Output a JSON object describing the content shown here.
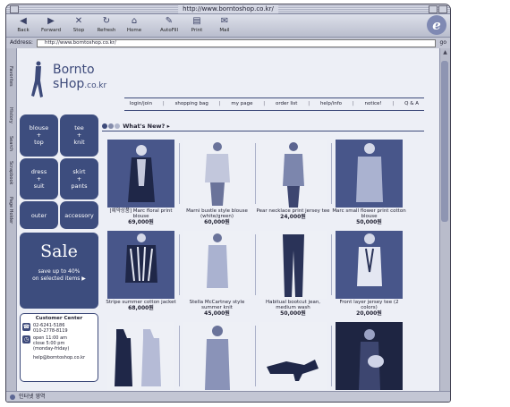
{
  "window": {
    "title": "http://www.borntoshop.co.kr/"
  },
  "toolbar": {
    "buttons": [
      {
        "label": "Back",
        "icon": "back-arrow-icon"
      },
      {
        "label": "Forward",
        "icon": "forward-arrow-icon"
      },
      {
        "label": "Stop",
        "icon": "stop-icon"
      },
      {
        "label": "Refresh",
        "icon": "refresh-icon"
      },
      {
        "label": "Home",
        "icon": "home-icon"
      },
      {
        "label": "AutoFill",
        "icon": "autofill-icon"
      },
      {
        "label": "Print",
        "icon": "print-icon"
      },
      {
        "label": "Mail",
        "icon": "mail-icon"
      }
    ],
    "logo": "e"
  },
  "address": {
    "label": "Address:",
    "value": "http://www.borntoshop.co.kr/",
    "go": "go"
  },
  "side_tabs": [
    "Favorites",
    "History",
    "Search",
    "Scrapbook",
    "Page Holder"
  ],
  "status": {
    "text": "인터넷 영역"
  },
  "site": {
    "logo_line1": "Bornto",
    "logo_line2": "sHop",
    "logo_suffix": ".co.kr",
    "nav": [
      "login/join",
      "shopping bag",
      "my page",
      "order list",
      "help/info",
      "notice!",
      "Q & A"
    ],
    "whats_new": "What's New?",
    "categories": [
      "blouse\n+\ntop",
      "tee\n+\nknit",
      "dress\n+\nsuit",
      "skirt\n+\npants",
      "outer",
      "accessory"
    ],
    "sale": {
      "title": "Sale",
      "line1": "save up to 40%",
      "line2": "on selected items ▶"
    },
    "customer_center": {
      "title": "Customer Center",
      "phone1": "02-6241-5186",
      "phone2": "010-2778-8119",
      "hours1": "open 11:00 am",
      "hours2": "close  5:00 pm",
      "hours3": "(monday-friday)",
      "email": "help@borntoshop.co.kr"
    },
    "products": [
      {
        "name": "[예약상품] Marc floral print blouse",
        "price": "69,000원"
      },
      {
        "name": "Marni bustle style blouse (white/green)",
        "price": "60,000원"
      },
      {
        "name": "Pear necklace print jersey tee",
        "price": "24,000원"
      },
      {
        "name": "Marc small flower print cotton blouse",
        "price": "50,000원"
      },
      {
        "name": "Stripe summer cotton jacket",
        "price": "68,000원"
      },
      {
        "name": "Stella McCartney style summer knit",
        "price": "45,000원"
      },
      {
        "name": "Habitual bootcut jean, medium wash",
        "price": "50,000원"
      },
      {
        "name": "Front layer jersey tee (2 colors)",
        "price": "20,000원"
      },
      {
        "name": "",
        "price": ""
      },
      {
        "name": "",
        "price": ""
      },
      {
        "name": "",
        "price": ""
      },
      {
        "name": "",
        "price": ""
      }
    ]
  }
}
